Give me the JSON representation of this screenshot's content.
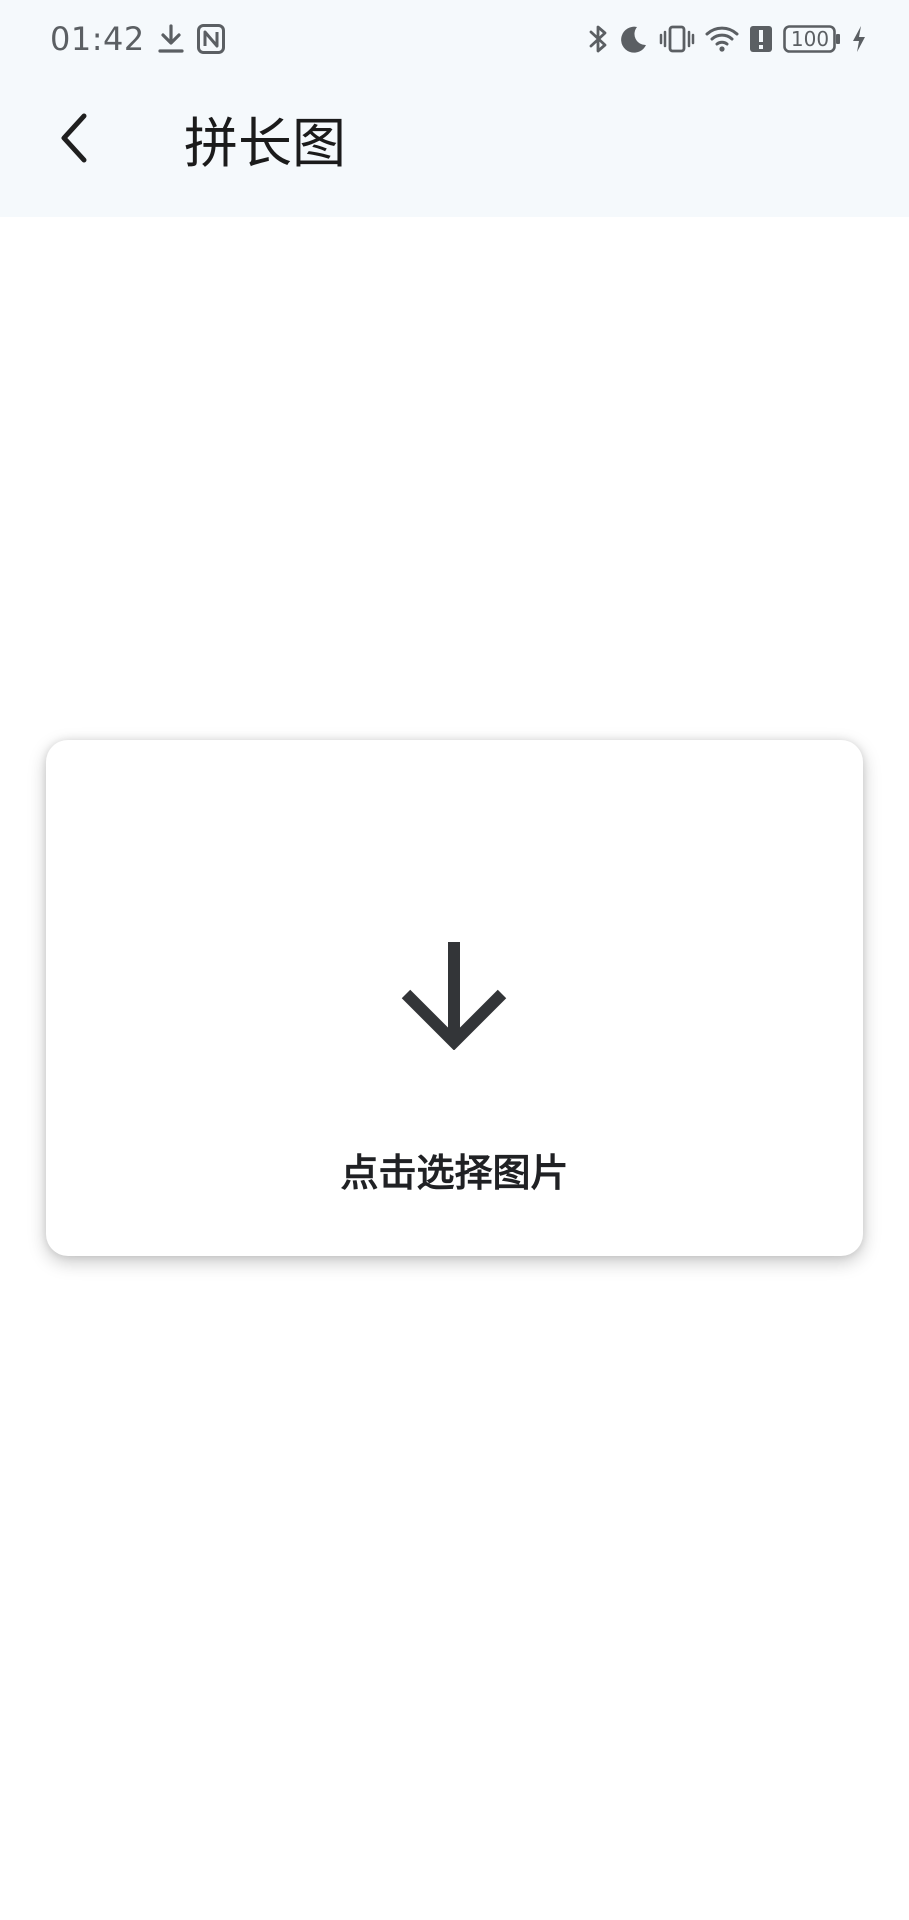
{
  "status_bar": {
    "time": "01:42",
    "battery_level": "100",
    "icons_left": [
      "download-icon",
      "nfc-icon"
    ],
    "icons_right": [
      "bluetooth-icon",
      "do-not-disturb-icon",
      "vibrate-icon",
      "wifi-icon",
      "alert-icon",
      "battery-icon",
      "charging-icon"
    ]
  },
  "app_bar": {
    "title": "拼长图",
    "back_icon": "chevron-left-icon"
  },
  "card": {
    "icon": "arrow-down-icon",
    "label": "点击选择图片"
  },
  "colors": {
    "top_background": "#f5f9fc",
    "page_background": "#ffffff",
    "icon_color": "#333538",
    "status_color": "#5b5f63"
  }
}
